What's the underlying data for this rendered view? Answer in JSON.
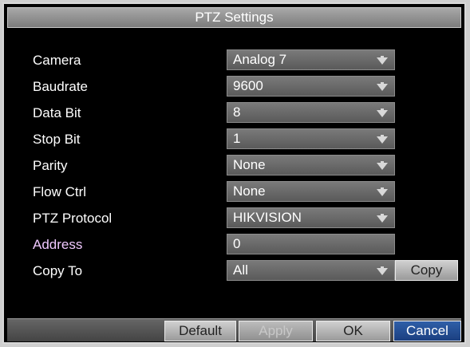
{
  "dialog": {
    "title": "PTZ Settings"
  },
  "settings": [
    {
      "label": "Camera",
      "value": "Analog 7",
      "has_dropdown": true
    },
    {
      "label": "Baudrate",
      "value": "9600",
      "has_dropdown": true
    },
    {
      "label": "Data Bit",
      "value": "8",
      "has_dropdown": true
    },
    {
      "label": "Stop Bit",
      "value": "1",
      "has_dropdown": true
    },
    {
      "label": "Parity",
      "value": "None",
      "has_dropdown": true
    },
    {
      "label": "Flow Ctrl",
      "value": "None",
      "has_dropdown": true
    },
    {
      "label": "PTZ Protocol",
      "value": "HIKVISION",
      "has_dropdown": true
    },
    {
      "label": "Address",
      "value": "0",
      "has_dropdown": false
    },
    {
      "label": "Copy To",
      "value": "All",
      "has_dropdown": true
    }
  ],
  "copy_button": "Copy",
  "footer": {
    "default_label": "Default",
    "apply_label": "Apply",
    "ok_label": "OK",
    "cancel_label": "Cancel"
  },
  "colors": {
    "background": "#000000",
    "titlebar": "#8e8e8e",
    "field": "#6a6a6a",
    "address_label": "#f0c8ff",
    "cancel_selected": "#2f5fa8"
  },
  "icons": {
    "dropdown": "chevron-down-icon"
  }
}
